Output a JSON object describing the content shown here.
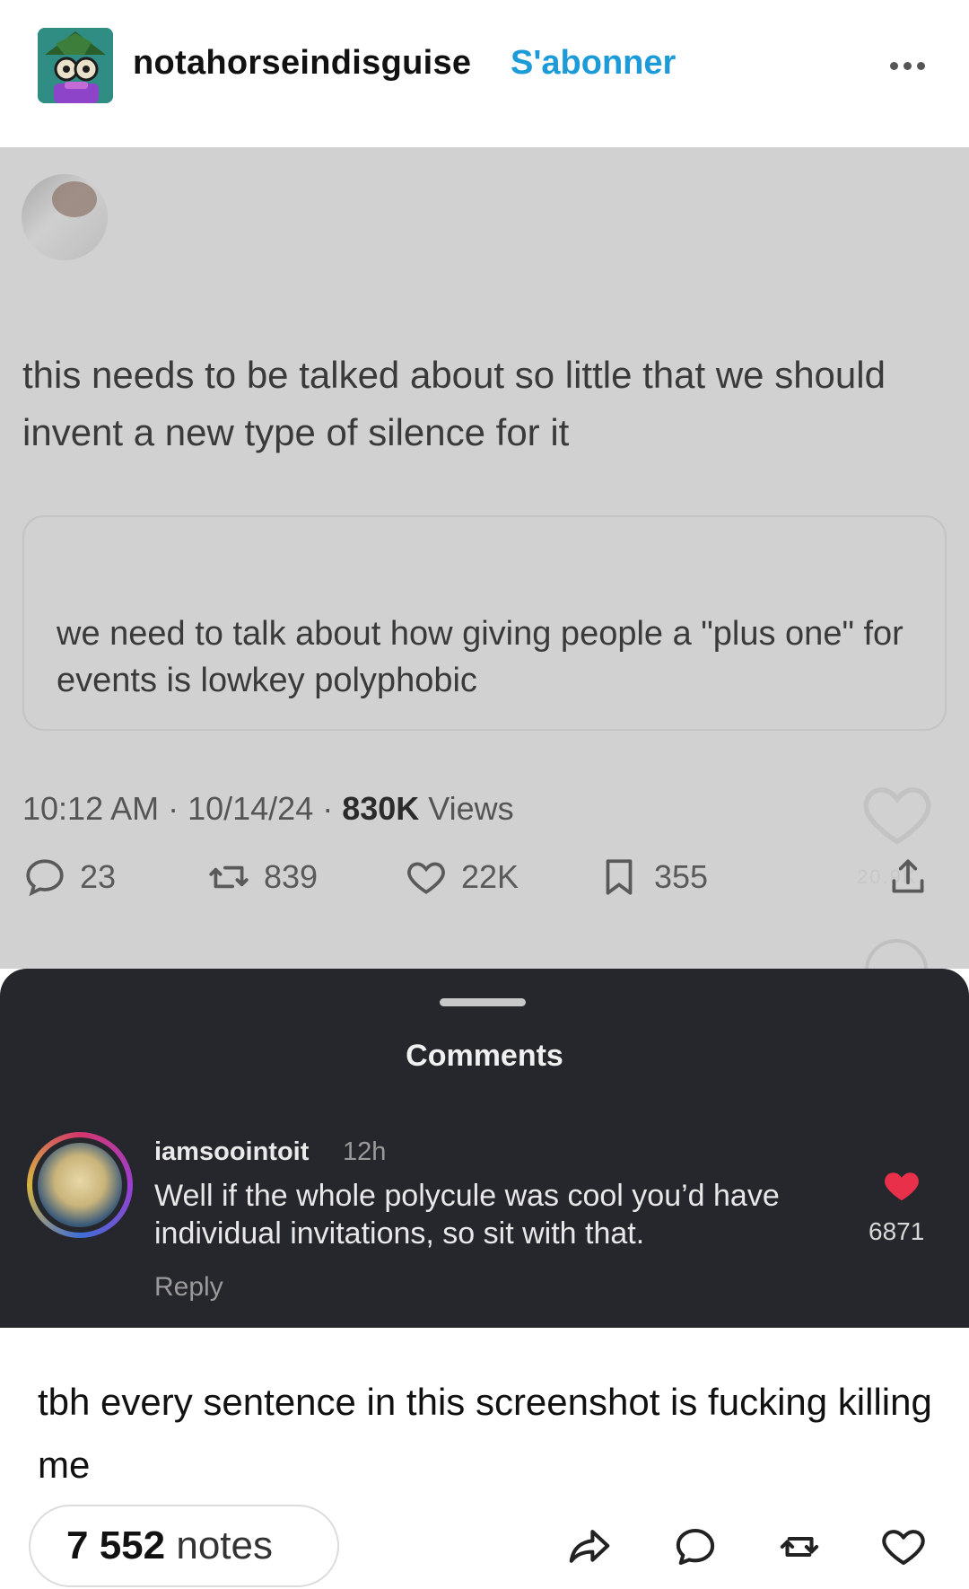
{
  "header": {
    "blog_name": "notahorseindisguise",
    "follow_label": "S'abonner",
    "avatar_icon": "avatar-icon",
    "more_icon": "more-icon"
  },
  "tweet": {
    "text": "this needs to be talked about so little that we should invent a new type of silence for it",
    "quoted_text": "we need to talk about how giving people a \"plus one\" for events is lowkey polyphobic",
    "meta_time": "10:12 AM · 10/14/24 · ",
    "meta_views_count": "830K",
    "meta_views_label": " Views",
    "replies": "23",
    "retweets": "839",
    "likes": "22K",
    "bookmarks": "355",
    "ghost_text": "20.9K"
  },
  "comments_panel": {
    "title": "Comments",
    "comment": {
      "username": "iamsoointoit",
      "time": "12h",
      "text": "Well if the whole polycule was cool you’d have individual invitations, so sit with that.",
      "reply_label": "Reply",
      "likes": "6871"
    }
  },
  "caption": "tbh every sentence in this screenshot is fucking killing me",
  "footer": {
    "notes_count": "7 552",
    "notes_label": "notes"
  },
  "colors": {
    "follow": "#1d9bd9",
    "panel_bg": "#25272c",
    "tweet_bg": "#d1d1d1",
    "like_red": "#e8304a"
  }
}
